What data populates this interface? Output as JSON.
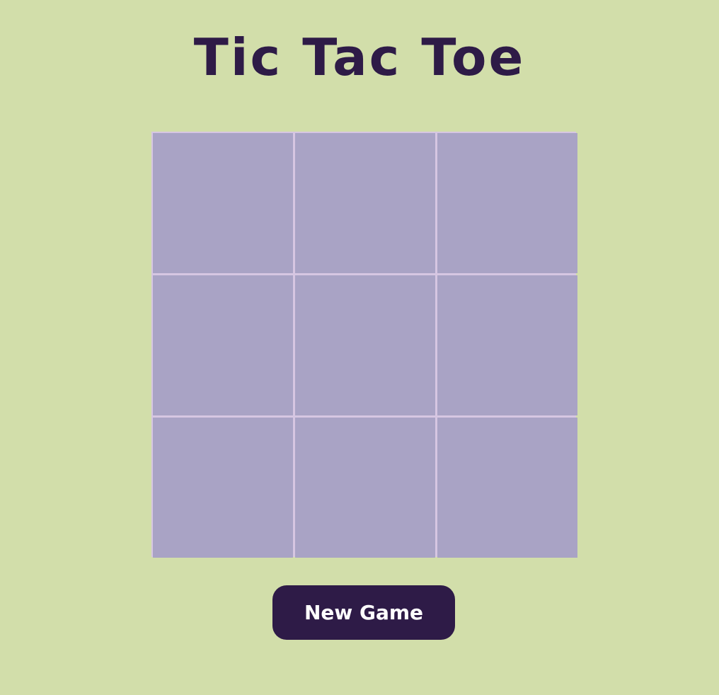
{
  "title": "Tic Tac Toe",
  "board": {
    "cells": [
      "",
      "",
      "",
      "",
      "",
      "",
      "",
      "",
      ""
    ]
  },
  "new_game_label": "New Game",
  "colors": {
    "background": "#d2deaa",
    "title_text": "#2e1b47",
    "cell_fill": "#a9a3c5",
    "grid_lines": "#d6c6e2",
    "button_fill": "#2e1b47",
    "button_text": "#ffffff"
  }
}
